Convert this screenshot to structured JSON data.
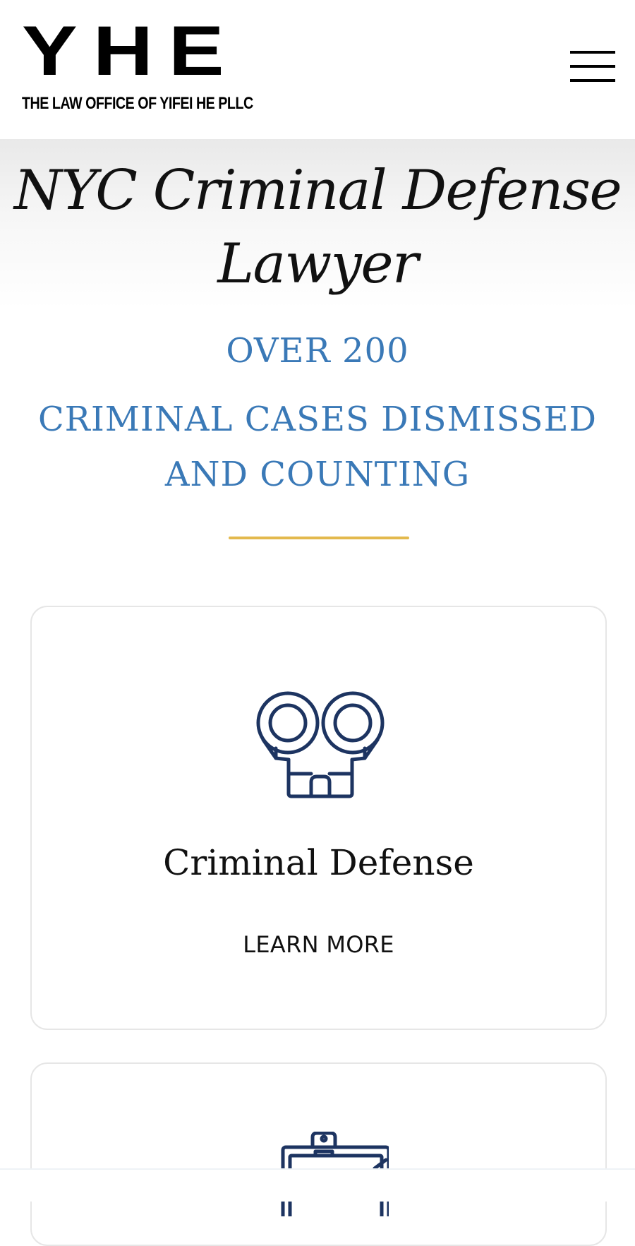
{
  "header": {
    "logo_mark": "YHE",
    "logo_subtitle": "THE LAW OFFICE OF YIFEI HE PLLC",
    "menu_icon": "hamburger-icon"
  },
  "hero": {
    "headline_line1": "NYC Criminal Defense",
    "headline_line2": "Lawyer"
  },
  "stats": {
    "line1": "OVER 200",
    "line2": "CRIMINAL CASES DISMISSED",
    "line3": "AND COUNTING"
  },
  "colors": {
    "accent_blue": "#3a79b7",
    "divider_gold": "#e3b94d",
    "icon_navy": "#1d3461"
  },
  "practice_areas": [
    {
      "icon": "handcuffs-icon",
      "title": "Criminal Defense",
      "link": "LEARN MORE"
    },
    {
      "icon": "clipboard-icon"
    }
  ]
}
